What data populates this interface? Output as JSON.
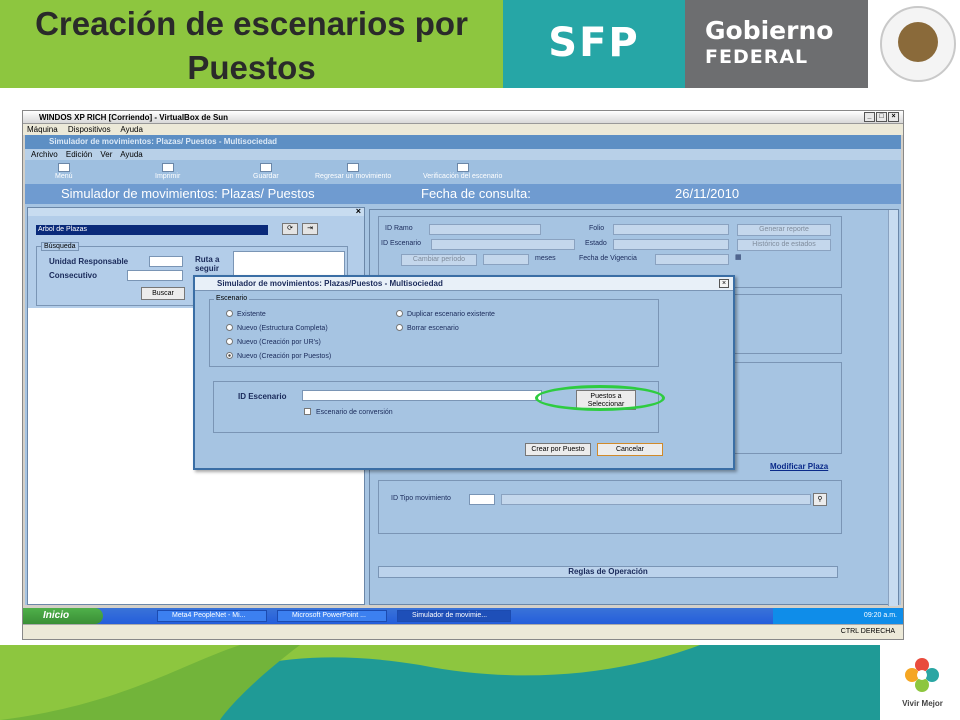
{
  "slide": {
    "title": "Creación de escenarios por Puestos",
    "brand_sfp": "SFP",
    "brand_gobierno": "Gobierno",
    "brand_federal": "FEDERAL",
    "footer_tagline": "Vivir Mejor"
  },
  "vbox": {
    "window_title": "WINDOS XP RICH [Corriendo] - VirtualBox de Sun",
    "menu": [
      "Máquina",
      "Dispositivos",
      "Ayuda"
    ],
    "status_host_key": "CTRL DERECHA"
  },
  "app": {
    "window_title": "Simulador de movimientos: Plazas/ Puestos - Multisociedad",
    "menu": [
      "Archivo",
      "Edición",
      "Ver",
      "Ayuda"
    ],
    "toolbar": [
      "Menú",
      "Imprimir",
      "Guardar",
      "Regresar un movimiento",
      "Verificación del escenario"
    ],
    "header_title": "Simulador de movimientos: Plazas/ Puestos",
    "header_fecha_label": "Fecha de consulta:",
    "header_fecha_value": "26/11/2010"
  },
  "left_panel": {
    "tree_title": "Arbol de Plazas",
    "busqueda_legend": "Búsqueda",
    "unidad_label": "Unidad Responsable",
    "consecutivo_label": "Consecutivo",
    "ruta_label": "Ruta a seguir",
    "buscar_button": "Buscar"
  },
  "right_panel": {
    "id_ramo_label": "ID Ramo",
    "folio_label": "Folio",
    "generar_button": "Generar reporte",
    "id_escenario_label": "ID Escenario",
    "estado_label": "Estado",
    "historico_button": "Histórico de estados",
    "cambiar_button": "Cambiar período",
    "meses_label": "meses",
    "fecha_vigencia_label": "Fecha de Vigencia",
    "modificar_link": "Modificar Plaza",
    "id_tipo_label": "ID Tipo movimiento",
    "reglas_header": "Reglas de Operación"
  },
  "modal": {
    "title": "Simulador de movimientos: Plazas/Puestos - Multisociedad",
    "escenario_legend": "Escenario",
    "options": [
      {
        "label": "Existente",
        "selected": false
      },
      {
        "label": "Nuevo (Estructura Completa)",
        "selected": false
      },
      {
        "label": "Nuevo (Creación por UR's)",
        "selected": false
      },
      {
        "label": "Nuevo (Creación por Puestos)",
        "selected": true
      },
      {
        "label": "Duplicar escenario existente",
        "selected": false
      },
      {
        "label": "Borrar escenario",
        "selected": false
      }
    ],
    "id_escenario_label": "ID Escenario",
    "puestos_button": "Puestos a Seleccionar",
    "conversion_label": "Escenario de conversión",
    "crear_button": "Crear por Puesto",
    "cancelar_button": "Cancelar"
  },
  "taskbar": {
    "start": "Inicio",
    "tasks": [
      "Meta4 PeopleNet - Mi...",
      "Microsoft PowerPoint ...",
      "Simulador de movimie..."
    ],
    "clock": "09:20 a.m."
  },
  "colors": {
    "slide_green": "#8dc63f",
    "sfp_teal": "#26a6a6",
    "gobierno_gray": "#6d6e70",
    "app_blue": "#a6c4e2",
    "highlight_green": "#2ecc40"
  }
}
